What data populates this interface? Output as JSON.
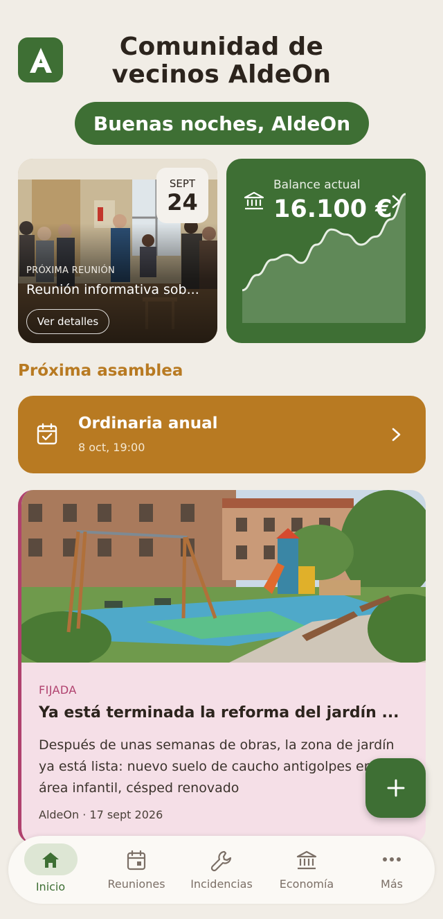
{
  "header": {
    "title": "Comunidad de vecinos AldeOn",
    "logo_letter": "A",
    "greeting": "Buenas noches, AldeOn"
  },
  "next_meeting": {
    "month": "SEPT",
    "day": "24",
    "kicker": "PRÓXIMA REUNIÓN",
    "title": "Reunión informativa sob...",
    "button": "Ver detalles"
  },
  "balance": {
    "label": "Balance actual",
    "amount": "16.100 €",
    "trend": [
      0.05,
      0.2,
      0.35,
      0.4,
      0.32,
      0.5,
      0.65,
      0.6,
      0.5,
      0.58,
      0.75,
      1.0
    ]
  },
  "assembly": {
    "section_title": "Próxima asamblea",
    "title": "Ordinaria anual",
    "date": "8 oct, 19:00"
  },
  "news": {
    "tag": "FIJADA",
    "title": "Ya está terminada la reforma del jardín ...",
    "body": "Después de unas semanas de obras, la zona de jardín ya está lista: nuevo suelo de caucho antigolpes en el área infantil, césped renovado",
    "meta": "AldeOn · 17 sept 2026"
  },
  "fab": {
    "icon": "plus-icon"
  },
  "nav": {
    "items": [
      {
        "label": "Inicio",
        "icon": "home-icon",
        "active": true
      },
      {
        "label": "Reuniones",
        "icon": "calendar-icon",
        "active": false
      },
      {
        "label": "Incidencias",
        "icon": "wrench-icon",
        "active": false
      },
      {
        "label": "Economía",
        "icon": "bank-icon",
        "active": false
      },
      {
        "label": "Más",
        "icon": "more-icon",
        "active": false
      }
    ]
  },
  "colors": {
    "primary": "#3e6f34",
    "accent": "#b87a22",
    "pinned": "#b0416e",
    "background": "#f1ede6"
  }
}
